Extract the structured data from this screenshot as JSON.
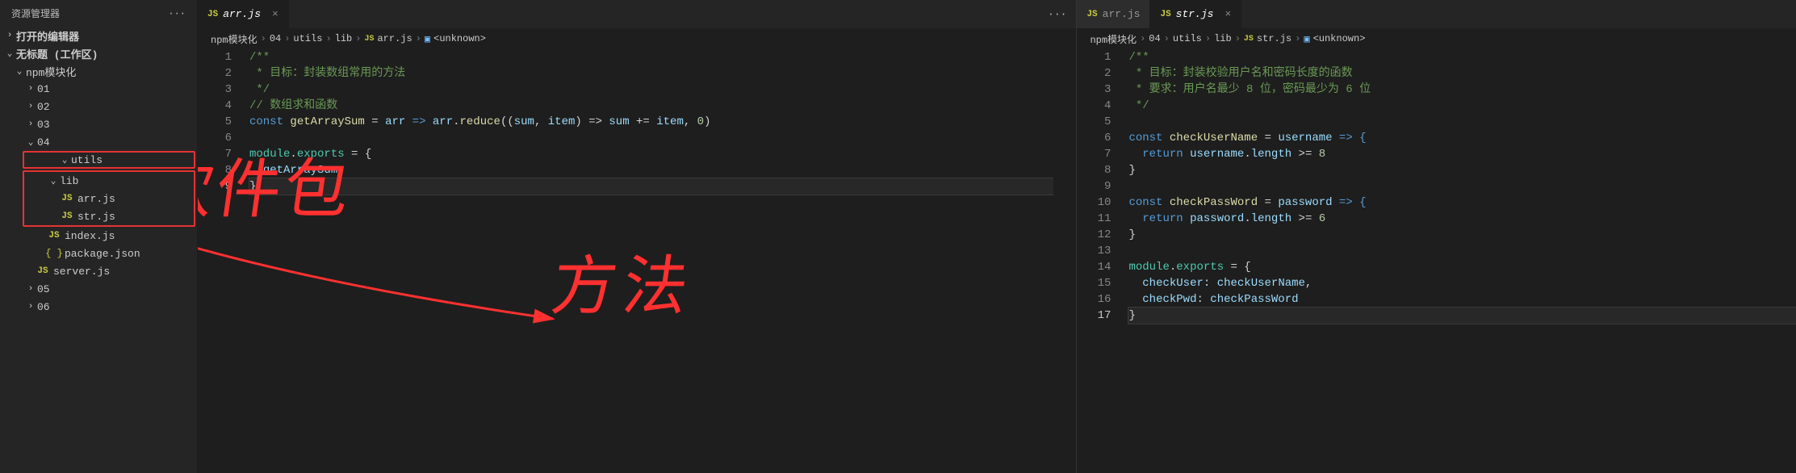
{
  "sidebar": {
    "title": "资源管理器",
    "sections": {
      "openEditors": "打开的编辑器",
      "workspace": "无标题 (工作区)"
    },
    "tree": {
      "root": "npm模块化",
      "folders": [
        "01",
        "02",
        "03",
        "04",
        "utils",
        "lib",
        "05",
        "06"
      ],
      "files": {
        "arr": "arr.js",
        "str": "str.js",
        "index": "index.js",
        "package": "package.json",
        "server": "server.js"
      }
    }
  },
  "editor1": {
    "tab": {
      "icon": "JS",
      "label": "arr.js"
    },
    "breadcrumb": [
      "npm模块化",
      "04",
      "utils",
      "lib",
      "arr.js",
      "<unknown>"
    ],
    "lines": {
      "1": "/**",
      "2": " * 目标：封装数组常用的方法",
      "3": " */",
      "4a": "// 数组求和函数",
      "5_const": "const",
      "5_fn": "getArraySum",
      "5_eq": " = ",
      "5_arr": "arr",
      "5_arrow": " => ",
      "5_arr2": "arr",
      "5_dot": ".",
      "5_reduce": "reduce",
      "5_p1": "((",
      "5_sum": "sum",
      "5_c1": ", ",
      "5_item": "item",
      "5_p2": ") => ",
      "5_sum2": "sum",
      "5_pluseq": " += ",
      "5_item2": "item",
      "5_c2": ", ",
      "5_zero": "0",
      "5_p3": ")",
      "7_mod": "module",
      "7_dot": ".",
      "7_exp": "exports",
      "7_eq": " = {",
      "8_get": "getArraySum",
      "9_close": "}"
    }
  },
  "editor2": {
    "tabs": [
      {
        "icon": "JS",
        "label": "arr.js"
      },
      {
        "icon": "JS",
        "label": "str.js"
      }
    ],
    "breadcrumb": [
      "npm模块化",
      "04",
      "utils",
      "lib",
      "str.js",
      "<unknown>"
    ],
    "lines": {
      "1": "/**",
      "2": " * 目标：封装校验用户名和密码长度的函数",
      "3": " * 要求：用户名最少 8 位，密码最少为 6 位",
      "4": " */",
      "6_const": "const",
      "6_fn": "checkUserName",
      "6_eq": " = ",
      "6_user": "username",
      "6_arrow": " => {",
      "7_ret": "return",
      "7_user": "username",
      "7_dot": ".",
      "7_len": "length",
      "7_gte": " >= ",
      "7_num": "8",
      "8_close": "}",
      "10_const": "const",
      "10_fn": "checkPassWord",
      "10_eq": " = ",
      "10_pass": "password",
      "10_arrow": " => {",
      "11_ret": "return",
      "11_pass": "password",
      "11_dot": ".",
      "11_len": "length",
      "11_gte": " >= ",
      "11_num": "6",
      "12_close": "}",
      "14_mod": "module",
      "14_dot": ".",
      "14_exp": "exports",
      "14_eq": " = {",
      "15_k": "checkUser",
      "15_c": ": ",
      "15_v": "checkUserName",
      "15_cm": ",",
      "16_k": "checkPwd",
      "16_c": ": ",
      "16_v": "checkPassWord",
      "17_close": "}"
    }
  },
  "annotations": {
    "text1": "软件包",
    "text2": "方法"
  },
  "icons": {
    "js": "JS",
    "json": "{ }",
    "chevron_right": "›",
    "chevron_down": "⌄",
    "dots": "···",
    "close": "×",
    "cube": "▣"
  }
}
